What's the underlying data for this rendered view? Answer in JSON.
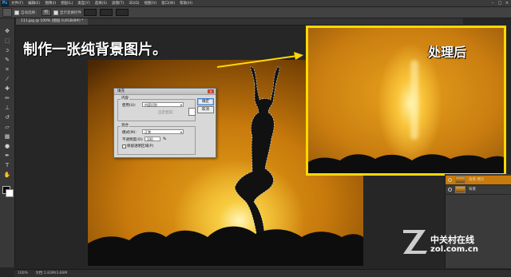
{
  "app": {
    "logo": "Ps"
  },
  "menu": [
    "文件(F)",
    "编辑(E)",
    "图像(I)",
    "图层(L)",
    "类型(Y)",
    "选择(S)",
    "滤镜(T)",
    "3D(D)",
    "视图(V)",
    "窗口(W)",
    "帮助(H)"
  ],
  "options": {
    "auto_select_label": "自动选择：",
    "auto_select_value": "组",
    "transform_controls_label": "显示变换控件"
  },
  "document_tab": {
    "title": "111.jpg @ 100% (图层 0,RGB/8#) *"
  },
  "captions": {
    "left": "制作一张纯背景图片。",
    "right": "处理后"
  },
  "fill_dialog": {
    "title": "填充",
    "ok_label": "确定",
    "cancel_label": "取消",
    "content_group": "内容",
    "use_label": "使用(U):",
    "use_value": "内容识别",
    "custom_pattern_label": "自定图案：",
    "blending_group": "混合",
    "mode_label": "模式(M):",
    "mode_value": "正常",
    "opacity_label": "不透明度(O):",
    "opacity_value": "100",
    "opacity_unit": "%",
    "preserve_transparency_label": "保留透明区域(P)"
  },
  "layers": [
    {
      "name": "背景 拷贝",
      "selected": true
    },
    {
      "name": "背景",
      "selected": false
    }
  ],
  "status": {
    "zoom": "100%",
    "doc_info": "文档:1.83M/3.66M"
  },
  "watermark": {
    "line1": "中关村在线",
    "line2": "zol.com.cn"
  },
  "colors": {
    "highlight_border": "#ffd800",
    "arrow": "#ffd800",
    "selection_active": "#c87a0c"
  }
}
